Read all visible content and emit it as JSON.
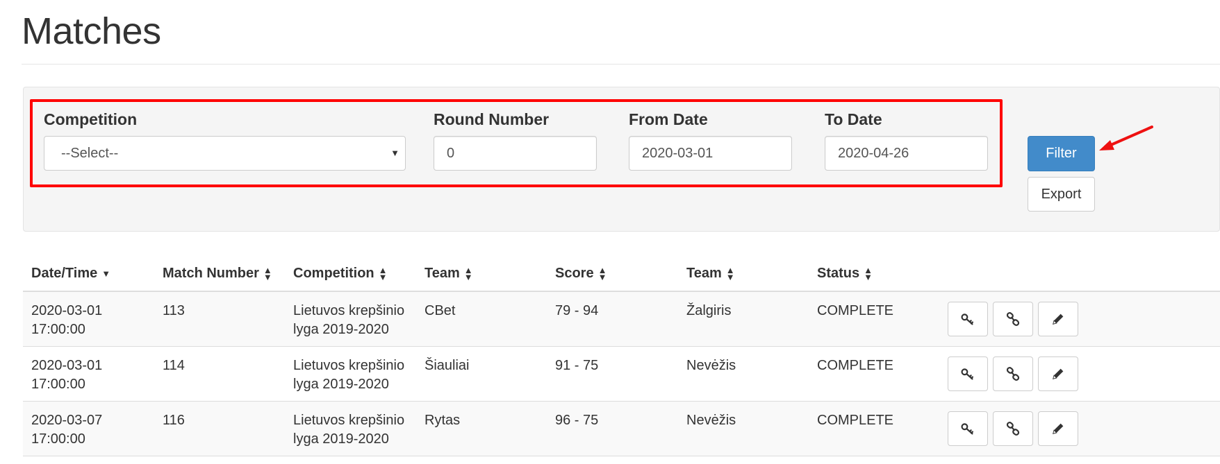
{
  "page": {
    "title": "Matches"
  },
  "filters": {
    "competition": {
      "label": "Competition",
      "value": "--Select--"
    },
    "round_number": {
      "label": "Round Number",
      "value": "0"
    },
    "from_date": {
      "label": "From Date",
      "value": "2020-03-01"
    },
    "to_date": {
      "label": "To Date",
      "value": "2020-04-26"
    },
    "filter_button": "Filter",
    "export_button": "Export"
  },
  "table": {
    "columns": [
      "Date/Time",
      "Match Number",
      "Competition",
      "Team",
      "Score",
      "Team",
      "Status"
    ],
    "rows": [
      {
        "date": "2020-03-01",
        "time": "17:00:00",
        "match_number": "113",
        "competition_line1": "Lietuvos krepšinio",
        "competition_line2": "lyga 2019-2020",
        "home_team": "CBet",
        "score": "79 - 94",
        "away_team": "Žalgiris",
        "status": "COMPLETE"
      },
      {
        "date": "2020-03-01",
        "time": "17:00:00",
        "match_number": "114",
        "competition_line1": "Lietuvos krepšinio",
        "competition_line2": "lyga 2019-2020",
        "home_team": "Šiauliai",
        "score": "91 - 75",
        "away_team": "Nevėžis",
        "status": "COMPLETE"
      },
      {
        "date": "2020-03-07",
        "time": "17:00:00",
        "match_number": "116",
        "competition_line1": "Lietuvos krepšinio",
        "competition_line2": "lyga 2019-2020",
        "home_team": "Rytas",
        "score": "96 - 75",
        "away_team": "Nevėžis",
        "status": "COMPLETE"
      }
    ],
    "row_actions": [
      "key-icon",
      "link-icon",
      "pencil-icon"
    ]
  },
  "colors": {
    "primary": "#428bca",
    "highlight": "#ff0000",
    "panel": "#f5f5f5"
  }
}
